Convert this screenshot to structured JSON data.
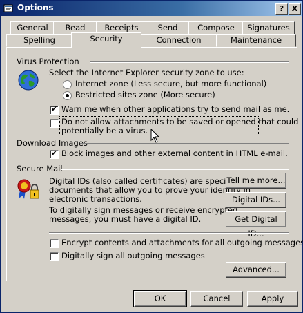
{
  "window": {
    "title": "Options",
    "help_btn": "?",
    "close_btn": "X"
  },
  "tabs_back": [
    {
      "label": "General"
    },
    {
      "label": "Read"
    },
    {
      "label": "Receipts"
    },
    {
      "label": "Send"
    },
    {
      "label": "Compose"
    },
    {
      "label": "Signatures"
    }
  ],
  "tabs_front": [
    {
      "label": "Spelling"
    },
    {
      "label": "Security"
    },
    {
      "label": "Connection"
    },
    {
      "label": "Maintenance"
    }
  ],
  "virus": {
    "heading": "Virus Protection",
    "zone_prompt": "Select the Internet Explorer security zone to use:",
    "radio_internet": "Internet zone (Less secure, but more functional)",
    "radio_restricted": "Restricted sites zone (More secure)",
    "warn_label": "Warn me when other applications try to send mail as me.",
    "attach_label_line1": "Do not allow attachments to be saved or opened that could",
    "attach_label_line2": "potentially be a virus."
  },
  "download": {
    "heading": "Download Images",
    "block_label": "Block images and other external content in HTML e-mail."
  },
  "secure": {
    "heading": "Secure Mail",
    "desc1": [
      "Digital IDs (also called certificates) are special",
      "documents that allow you to prove your identity in",
      "electronic transactions."
    ],
    "desc2": [
      "To digitally sign messages or receive encrypted",
      "messages, you must have a digital ID."
    ],
    "tell_btn": "Tell me more...",
    "ids_btn": "Digital IDs...",
    "get_btn": "Get Digital ID...",
    "encrypt_label": "Encrypt contents and attachments for all outgoing messages",
    "sign_label": "Digitally sign all outgoing messages",
    "advanced_btn": "Advanced..."
  },
  "footer": {
    "ok": "OK",
    "cancel": "Cancel",
    "apply": "Apply"
  },
  "colors": {
    "titlebar": "#0a246a",
    "face": "#d4d0c8"
  }
}
